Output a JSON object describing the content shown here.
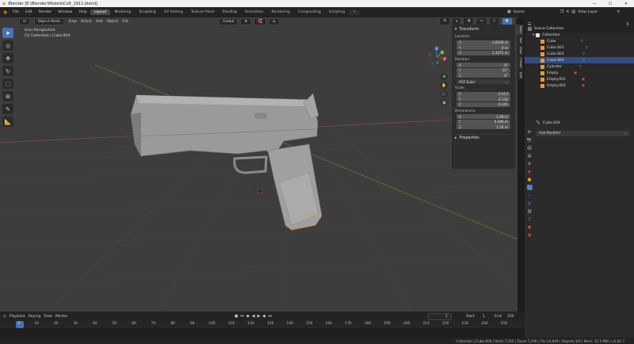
{
  "window": {
    "title": "Blender [E:\\Blender\\Models\\Colt_1911.blend]",
    "minimize": "—",
    "maximize": "☐",
    "close": "✕"
  },
  "menu": [
    "File",
    "Edit",
    "Render",
    "Window",
    "Help"
  ],
  "workspaces": [
    "Layout",
    "Modeling",
    "Sculpting",
    "UV Editing",
    "Texture Paint",
    "Shading",
    "Animation",
    "Rendering",
    "Compositing",
    "Scripting"
  ],
  "workspace_add": "+",
  "scene": {
    "label": "Scene",
    "view_layer": "View Layer"
  },
  "viewport": {
    "mode": "Object Mode",
    "menus": [
      "View",
      "Select",
      "Add",
      "Object",
      "GIS"
    ],
    "transform_orient": "Global",
    "info_line1": "User Perspective",
    "info_line2": "(1) Collection | Cube.004",
    "gizmo": {
      "x": "X",
      "y": "Y",
      "z": "Z"
    }
  },
  "npanel": {
    "transform_title": "Transform",
    "location_label": "Location:",
    "location": [
      {
        "axis": "X",
        "value": "-1.8339 m"
      },
      {
        "axis": "Y",
        "value": "0 m"
      },
      {
        "axis": "Z",
        "value": "1.3271 m"
      }
    ],
    "rotation_label": "Rotation:",
    "rotation": [
      {
        "axis": "X",
        "value": "0°"
      },
      {
        "axis": "Y",
        "value": "11°"
      },
      {
        "axis": "Z",
        "value": "0°"
      }
    ],
    "euler": "XYZ Euler",
    "scale_label": "Scale:",
    "scale": [
      {
        "axis": "X",
        "value": "0.413"
      },
      {
        "axis": "Y",
        "value": "0.134"
      },
      {
        "axis": "Z",
        "value": "0.141"
      }
    ],
    "dimensions_label": "Dimensions:",
    "dimensions": [
      {
        "axis": "X",
        "value": "1.09 m"
      },
      {
        "axis": "Y",
        "value": "0.246 m"
      },
      {
        "axis": "Z",
        "value": "1.54 m"
      }
    ],
    "properties_title": "Properties",
    "tabs": [
      "Item",
      "Tool",
      "View",
      "Create",
      "Edit"
    ]
  },
  "outliner": {
    "rows": [
      {
        "name": "Scene Collection",
        "indent": 0,
        "type": "scene"
      },
      {
        "name": "Collection",
        "indent": 1,
        "type": "collection"
      },
      {
        "name": "Cube",
        "indent": 2,
        "type": "mesh"
      },
      {
        "name": "Cube.001",
        "indent": 2,
        "type": "mesh"
      },
      {
        "name": "Cube.003",
        "indent": 2,
        "type": "mesh"
      },
      {
        "name": "Cube.004",
        "indent": 2,
        "type": "mesh",
        "selected": true
      },
      {
        "name": "Cylinder",
        "indent": 2,
        "type": "mesh"
      },
      {
        "name": "Empty",
        "indent": 2,
        "type": "empty"
      },
      {
        "name": "Empty.001",
        "indent": 2,
        "type": "empty"
      },
      {
        "name": "Empty.002",
        "indent": 2,
        "type": "empty"
      }
    ]
  },
  "properties": {
    "object_name": "Cube.004",
    "add_modifier": "Add Modifier"
  },
  "timeline": {
    "menus": [
      "Playback",
      "Keying",
      "View",
      "Marker"
    ],
    "current_frame": "1",
    "start_label": "Start",
    "start": "1",
    "end_label": "End",
    "end": "250",
    "ticks": [
      "1",
      "10",
      "20",
      "30",
      "40",
      "50",
      "60",
      "70",
      "80",
      "90",
      "100",
      "110",
      "120",
      "130",
      "140",
      "150",
      "160",
      "170",
      "180",
      "190",
      "200",
      "210",
      "220",
      "230",
      "240",
      "250"
    ]
  },
  "status": "Collection | Cube.004 | Verts:7,542 | Faces:7,246 | Tris:14,849 | Objects:1/6 | Mem: 32.5 MiB | v2.82.7",
  "colors": {
    "accent": "#4772b3",
    "x_axis": "#c83c4a",
    "y_axis": "#6c9c1e",
    "z_axis": "#3b79c9"
  }
}
